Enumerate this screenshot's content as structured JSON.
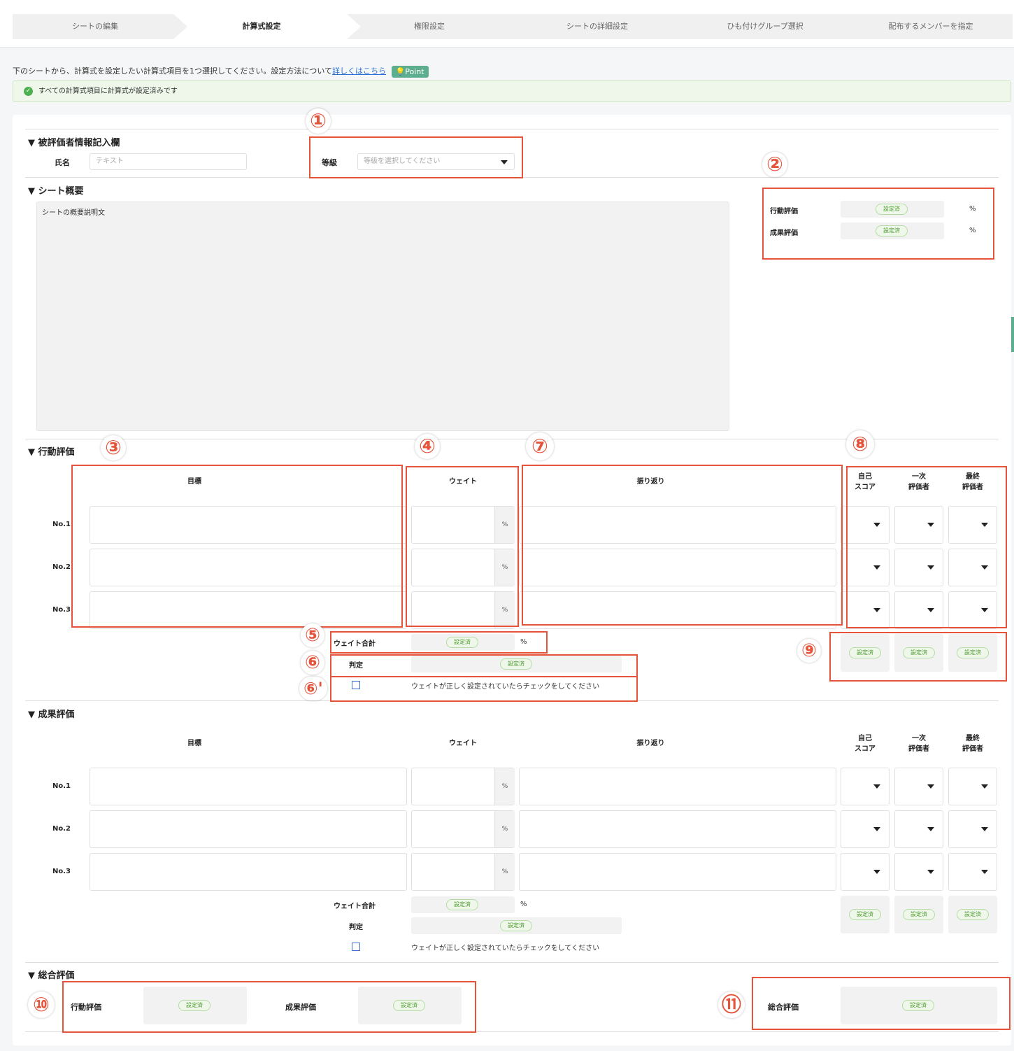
{
  "steps": [
    "シートの編集",
    "計算式設定",
    "権限設定",
    "シートの詳細設定",
    "ひも付けグループ選択",
    "配布するメンバーを指定"
  ],
  "instruction": {
    "text": "下のシートから、計算式を設定したい計算式項目を1つ選択してください。設定方法について",
    "link": "詳しくはこちら",
    "point": "Point"
  },
  "banner": "すべての計算式項目に計算式が設定済みです",
  "set_label": "設定済",
  "pct": "%",
  "evaluatee": {
    "title": "▼ 被評価者情報記入欄",
    "name_label": "氏名",
    "name_placeholder": "テキスト",
    "grade_label": "等級",
    "grade_placeholder": "等級を選択してください"
  },
  "overview": {
    "title": "▼ シート概要",
    "text": "シートの概要説明文",
    "weights": [
      {
        "label": "行動評価"
      },
      {
        "label": "成果評価"
      }
    ]
  },
  "behavior": {
    "title": "▼ 行動評価",
    "col_goal": "目標",
    "col_weight": "ウェイト",
    "col_review": "振り返り",
    "col_self": "自己\nスコア",
    "col_first": "一次\n評価者",
    "col_final": "最終\n評価者",
    "rows": [
      "No.1",
      "No.2",
      "No.3"
    ],
    "weight_total": "ウェイト合計",
    "judge": "判定",
    "check_text": "ウェイトが正しく設定されていたらチェックをしてください"
  },
  "result": {
    "title": "▼ 成果評価",
    "col_goal": "目標",
    "col_weight": "ウェイト",
    "col_review": "振り返り",
    "col_self": "自己\nスコア",
    "col_first": "一次\n評価者",
    "col_final": "最終\n評価者",
    "rows": [
      "No.1",
      "No.2",
      "No.3"
    ],
    "weight_total": "ウェイト合計",
    "judge": "判定",
    "check_text": "ウェイトが正しく設定されていたらチェックをしてください"
  },
  "total": {
    "title": "▼ 総合評価",
    "behavior": "行動評価",
    "result": "成果評価",
    "overall": "総合評価"
  },
  "markers": [
    "①",
    "②",
    "③",
    "④",
    "⑤",
    "⑥",
    "⑥'",
    "⑦",
    "⑧",
    "⑨",
    "⑩",
    "⑪"
  ],
  "colors": {
    "annotation_red": "#e5533b",
    "set_green": "#4a9a2a",
    "point_green": "#5cae8e"
  }
}
